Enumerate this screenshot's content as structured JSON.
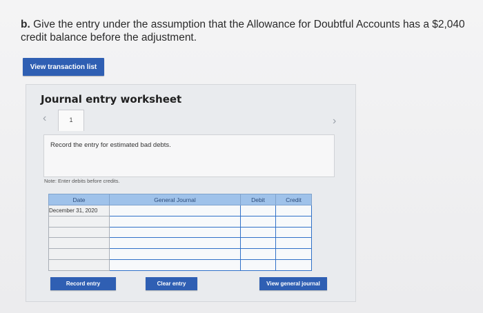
{
  "question": {
    "label": "b.",
    "text": "Give the entry under the assumption that the Allowance for Doubtful Accounts has a $2,040 credit balance before the adjustment."
  },
  "view_transaction_list_label": "View transaction list",
  "worksheet": {
    "title": "Journal entry worksheet",
    "current_tab": "1",
    "instruction": "Record the entry for estimated bad debts.",
    "note": "Note: Enter debits before credits.",
    "table": {
      "headers": [
        "Date",
        "General Journal",
        "Debit",
        "Credit"
      ],
      "first_date": "December 31, 2020",
      "rows": 6
    },
    "buttons": {
      "record": "Record entry",
      "clear": "Clear entry",
      "view_journal": "View general journal"
    }
  },
  "colors": {
    "button_blue": "#2f5fb3",
    "header_blue": "#9fc2ea",
    "input_border": "#2f70c8"
  }
}
